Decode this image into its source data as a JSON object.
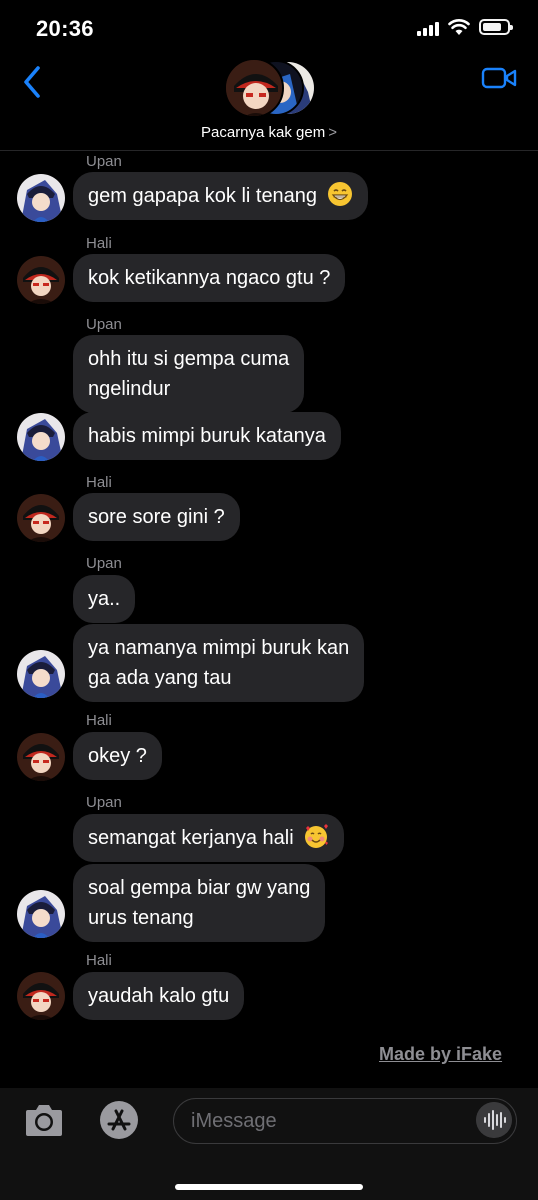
{
  "status_bar": {
    "time": "20:36"
  },
  "header": {
    "contact_name": "Pacarnya kak gem",
    "chevron": ">"
  },
  "messages": [
    {
      "sender": "Upan",
      "text": "gem gapapa kok li tenang",
      "emoji": "grin"
    },
    {
      "sender": "Hali",
      "text": "kok ketikannya ngaco gtu ?"
    },
    {
      "sender": "Upan",
      "lines": [
        "ohh itu si gempa cuma",
        "ngelindur"
      ]
    },
    {
      "text": "habis mimpi buruk katanya"
    },
    {
      "sender": "Hali",
      "text": "sore sore gini ?"
    },
    {
      "sender": "Upan",
      "text": "ya.."
    },
    {
      "lines": [
        "ya namanya mimpi buruk kan",
        "ga ada yang tau"
      ]
    },
    {
      "sender": "Hali",
      "text": "okey ?"
    },
    {
      "sender": "Upan",
      "text": "semangat kerjanya hali",
      "emoji": "smiling-hearts"
    },
    {
      "lines": [
        "soal gempa biar gw yang",
        "urus tenang"
      ]
    },
    {
      "sender": "Hali",
      "text": "yaudah kalo gtu"
    }
  ],
  "watermark": "Made by iFake",
  "input": {
    "placeholder": "iMessage"
  },
  "icons": {
    "back": "chevron-left-icon",
    "video": "video-camera-icon",
    "camera": "camera-icon",
    "appstore": "app-store-icon",
    "audio": "audio-waveform-icon"
  },
  "colors": {
    "accent": "#1a82fb",
    "bubble": "#262629",
    "sender": "#8e8e93",
    "background": "#000000"
  }
}
